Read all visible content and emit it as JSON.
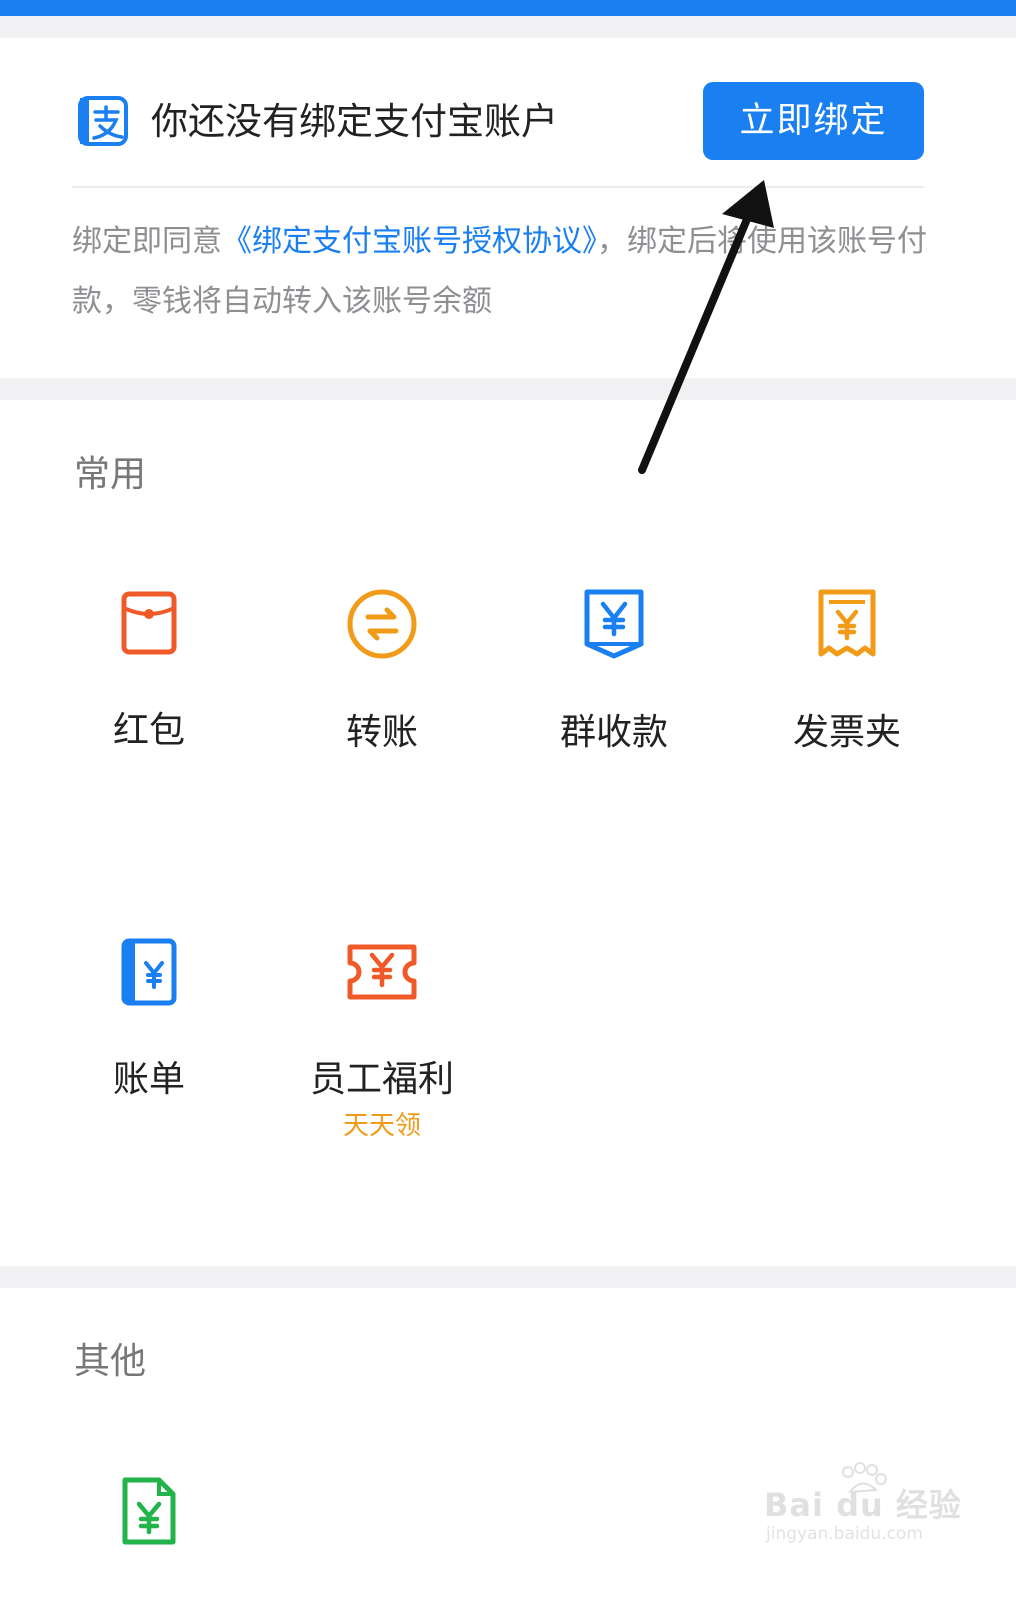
{
  "bind_card": {
    "icon": "alipay-icon",
    "title": "你还没有绑定支付宝账户",
    "bind_button": "立即绑定",
    "desc_prefix": "绑定即同意",
    "desc_link": "《绑定支付宝账号授权协议》",
    "desc_suffix": "，绑定后将使用该账号付款，零钱将自动转入该账号余额"
  },
  "common": {
    "title": "常用",
    "items": [
      {
        "label": "红包",
        "icon": "red-packet-icon",
        "color": "#f05a28"
      },
      {
        "label": "转账",
        "icon": "transfer-icon",
        "color": "#f29b18"
      },
      {
        "label": "群收款",
        "icon": "group-collect-icon",
        "color": "#1a7ff0"
      },
      {
        "label": "发票夹",
        "icon": "invoice-folder-icon",
        "color": "#f29b18"
      },
      {
        "label": "账单",
        "icon": "bill-icon",
        "color": "#1a7ff0"
      },
      {
        "label": "员工福利",
        "sub": "天天领",
        "icon": "employee-benefit-icon",
        "color": "#f05a28"
      }
    ]
  },
  "other": {
    "title": "其他",
    "items": [
      {
        "icon": "document-yen-icon",
        "color": "#22b34a"
      }
    ]
  },
  "watermark": {
    "main": "Bai du 经验",
    "sub": "jingyan.baidu.com"
  },
  "colors": {
    "accent": "#1a7ff0",
    "top_bar": "#1a7ff0",
    "orange": "#f29b18",
    "red_orange": "#f05a28",
    "green": "#22b34a"
  }
}
